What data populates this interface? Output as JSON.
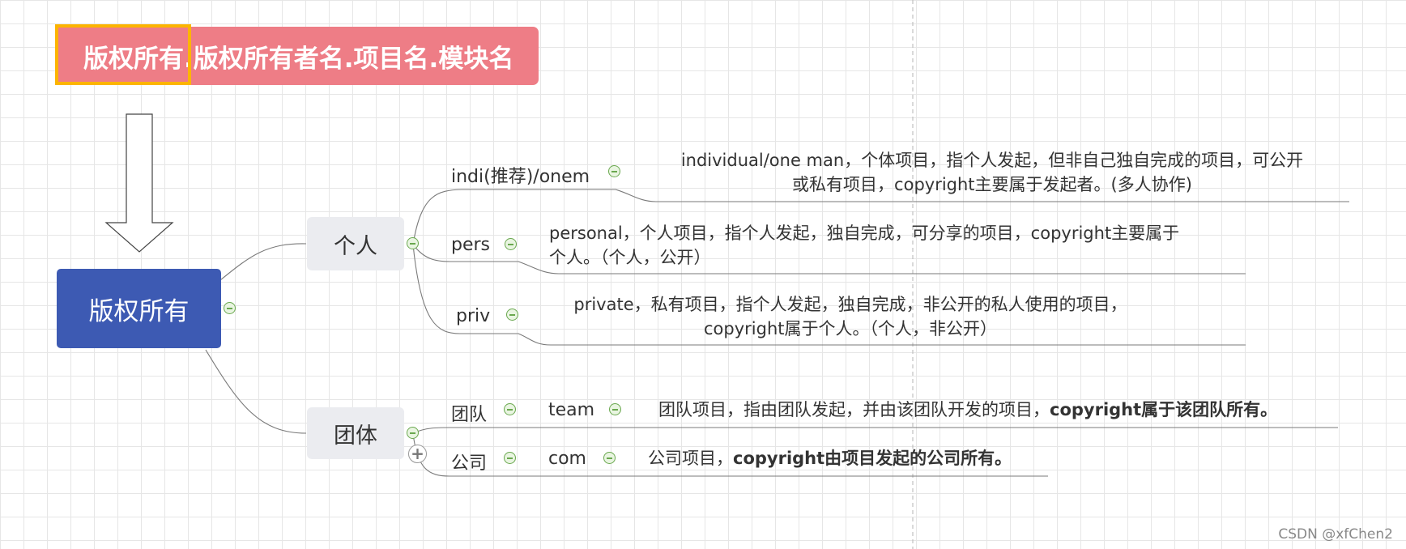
{
  "banner": {
    "highlight": "版权所有",
    "rest": ".版权所有者名.项目名.模块名"
  },
  "root": "版权所有",
  "groups": {
    "personal": {
      "label": "个人",
      "items": {
        "indi": {
          "label": "indi(推荐)/onem",
          "desc_line1": "individual/one man，个体项目，指个人发起，但非自己独自完成的项目，可公开",
          "desc_line2": "或私有项目，copyright主要属于发起者。(多人协作)"
        },
        "pers": {
          "label": "pers",
          "desc_line1": "personal，个人项目，指个人发起，独自完成，可分享的项目，copyright主要属于",
          "desc_line2": "个人。（个人，公开）"
        },
        "priv": {
          "label": "priv",
          "desc_line1": "private，私有项目，指个人发起，独自完成，非公开的私人使用的项目，",
          "desc_line2": "copyright属于个人。（个人，非公开）"
        }
      }
    },
    "group": {
      "label": "团体",
      "items": {
        "team": {
          "label": "团队",
          "sub": "team",
          "desc_plain": "团队项目，指由团队发起，并由该团队开发的项目，",
          "desc_bold": "copyright属于该团队所有。"
        },
        "com": {
          "label": "公司",
          "sub": "com",
          "desc_plain": "公司项目，",
          "desc_bold": "copyright由项目发起的公司所有。"
        }
      }
    }
  },
  "colors": {
    "banner": "#ee7d86",
    "highlight_border": "#fcb400",
    "root": "#3d5ab3",
    "node": "#ebecf0",
    "toggle": "#6aa84f"
  },
  "icons": {
    "collapse": "minus-circle-icon",
    "expand": "plus-circle-icon",
    "arrow": "down-arrow-icon"
  },
  "watermark": "CSDN @xfChen2"
}
